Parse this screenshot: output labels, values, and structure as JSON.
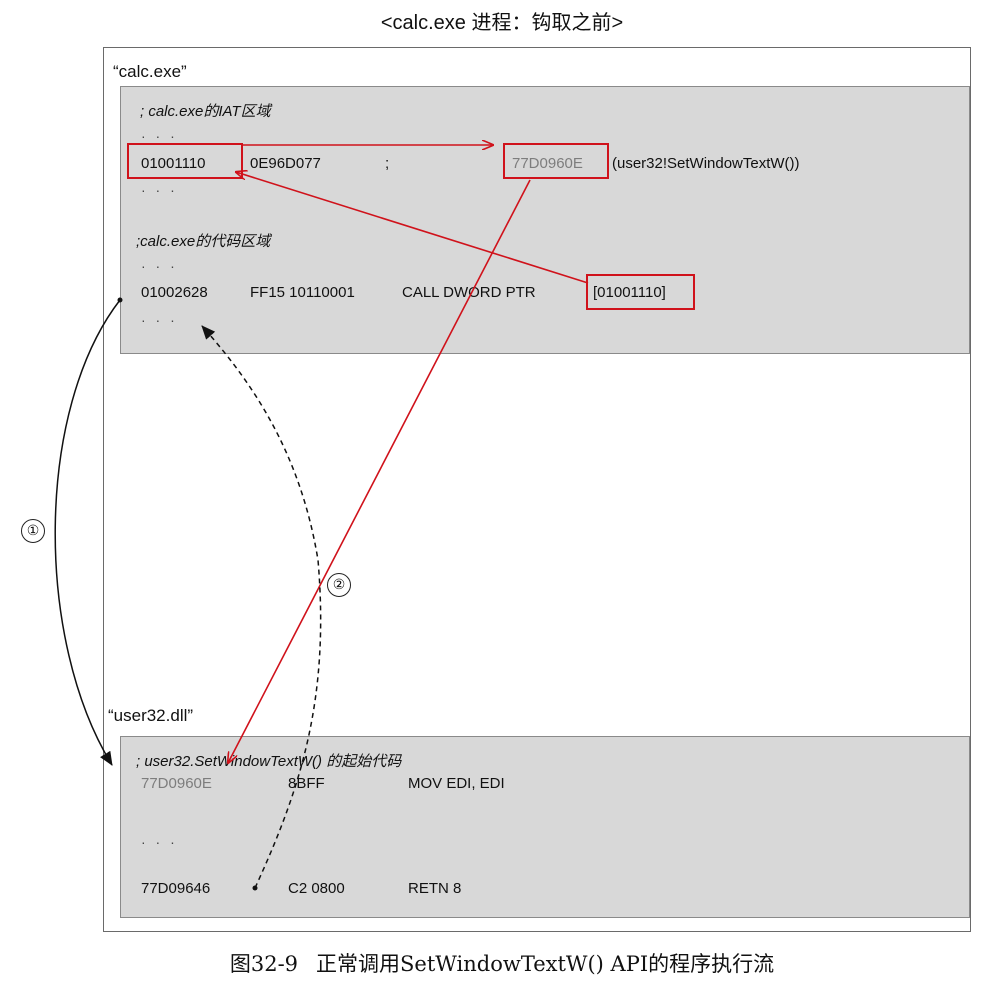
{
  "title": "<calc.exe 进程：钩取之前>",
  "calc_process": {
    "label": "“calc.exe”",
    "iat_comment": "; calc.exe的IAT区域",
    "ellipsis": "· · ·",
    "iat_addr": "01001110",
    "iat_value": "0E96D077",
    "iat_semicolon": ";",
    "iat_target": "77D0960E",
    "iat_target_name": "(user32!SetWindowTextW())",
    "code_comment": ";calc.exe的代码区域",
    "code_addr": "01002628",
    "code_bytes": "FF15 10110001",
    "code_instr": "CALL DWORD PTR",
    "code_operand": "[01001110]"
  },
  "user32": {
    "label": "“user32.dll”",
    "comment": "; user32.SetWindowTextW() 的起始代码",
    "row1_addr": "77D0960E",
    "row1_bytes": "8BFF",
    "row1_instr": "MOV EDI, EDI",
    "ellipsis": "· · ·",
    "row2_addr": "77D09646",
    "row2_bytes": "C2 0800",
    "row2_instr": "RETN 8"
  },
  "markers": {
    "step1": "①",
    "step2": "②"
  },
  "caption": {
    "number": "图32-9",
    "text": "正常调用SetWindowTextW() API的程序执行流"
  },
  "colors": {
    "highlight": "#d0121b",
    "region_fill": "#d8d8d8"
  }
}
